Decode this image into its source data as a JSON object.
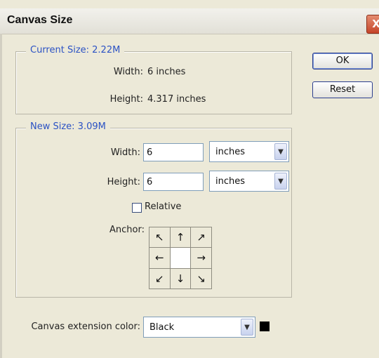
{
  "window": {
    "title": "Canvas Size",
    "close": "X"
  },
  "current_size": {
    "legend": "Current Size: 2.22M",
    "width_label": "Width:",
    "width_value": "6 inches",
    "height_label": "Height:",
    "height_value": "4.317 inches"
  },
  "buttons": {
    "ok": "OK",
    "reset": "Reset"
  },
  "new_size": {
    "legend": "New Size: 3.09M",
    "width_label": "Width:",
    "width_value": "6",
    "width_unit": "inches",
    "height_label": "Height:",
    "height_value": "6",
    "height_unit": "inches",
    "relative_label": "Relative",
    "relative_checked": false,
    "anchor_label": "Anchor:"
  },
  "anchor_grid": [
    {
      "name": "anchor-top-left",
      "glyph": "↖"
    },
    {
      "name": "anchor-top",
      "glyph": "↑"
    },
    {
      "name": "anchor-top-right",
      "glyph": "↗"
    },
    {
      "name": "anchor-left",
      "glyph": "←"
    },
    {
      "name": "anchor-center",
      "glyph": ""
    },
    {
      "name": "anchor-right",
      "glyph": "→"
    },
    {
      "name": "anchor-bottom-left",
      "glyph": "↙"
    },
    {
      "name": "anchor-bottom",
      "glyph": "↓"
    },
    {
      "name": "anchor-bottom-right",
      "glyph": "↘"
    }
  ],
  "extension": {
    "label": "Canvas extension color:",
    "value": "Black",
    "swatch_color": "#000000"
  },
  "colors": {
    "legend": "#2b52c4",
    "dialog_bg": "#ece9d8",
    "close_button": "#c5452a"
  }
}
